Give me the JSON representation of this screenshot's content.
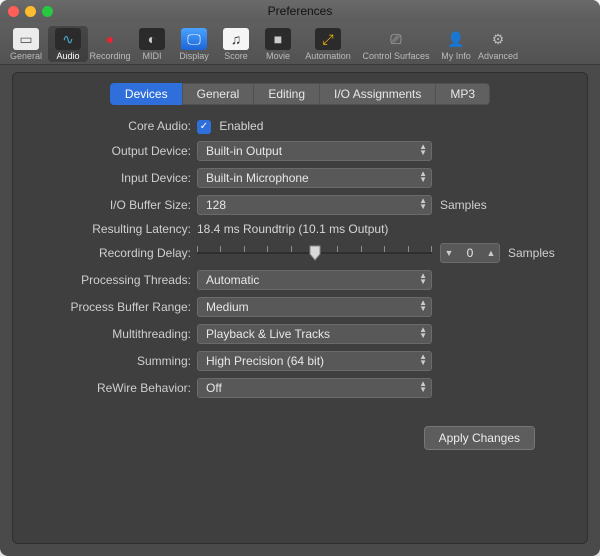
{
  "window": {
    "title": "Preferences"
  },
  "toolbar": {
    "items": [
      {
        "label": "General",
        "icon": "▭"
      },
      {
        "label": "Audio",
        "icon": "∿"
      },
      {
        "label": "Recording",
        "icon": "●"
      },
      {
        "label": "MIDI",
        "icon": "◐"
      },
      {
        "label": "Display",
        "icon": "🖵"
      },
      {
        "label": "Score",
        "icon": "♫"
      },
      {
        "label": "Movie",
        "icon": "■"
      },
      {
        "label": "Automation",
        "icon": "⤢"
      },
      {
        "label": "Control Surfaces",
        "icon": "⎚"
      },
      {
        "label": "My Info",
        "icon": "👤"
      },
      {
        "label": "Advanced",
        "icon": "⚙"
      }
    ],
    "selected": 1
  },
  "tabs": {
    "items": [
      "Devices",
      "General",
      "Editing",
      "I/O Assignments",
      "MP3"
    ],
    "active": 0
  },
  "form": {
    "core_audio": {
      "label": "Core Audio:",
      "checkbox_label": "Enabled",
      "checked": true
    },
    "output_device": {
      "label": "Output Device:",
      "value": "Built-in Output"
    },
    "input_device": {
      "label": "Input Device:",
      "value": "Built-in Microphone"
    },
    "io_buffer": {
      "label": "I/O Buffer Size:",
      "value": "128",
      "suffix": "Samples"
    },
    "resulting_latency": {
      "label": "Resulting Latency:",
      "value": "18.4 ms Roundtrip (10.1 ms Output)"
    },
    "recording_delay": {
      "label": "Recording Delay:",
      "value": "0",
      "suffix": "Samples"
    },
    "processing_threads": {
      "label": "Processing Threads:",
      "value": "Automatic"
    },
    "process_buffer": {
      "label": "Process Buffer Range:",
      "value": "Medium"
    },
    "multithreading": {
      "label": "Multithreading:",
      "value": "Playback & Live Tracks"
    },
    "summing": {
      "label": "Summing:",
      "value": "High Precision (64 bit)"
    },
    "rewire": {
      "label": "ReWire Behavior:",
      "value": "Off"
    }
  },
  "buttons": {
    "apply": "Apply Changes"
  }
}
